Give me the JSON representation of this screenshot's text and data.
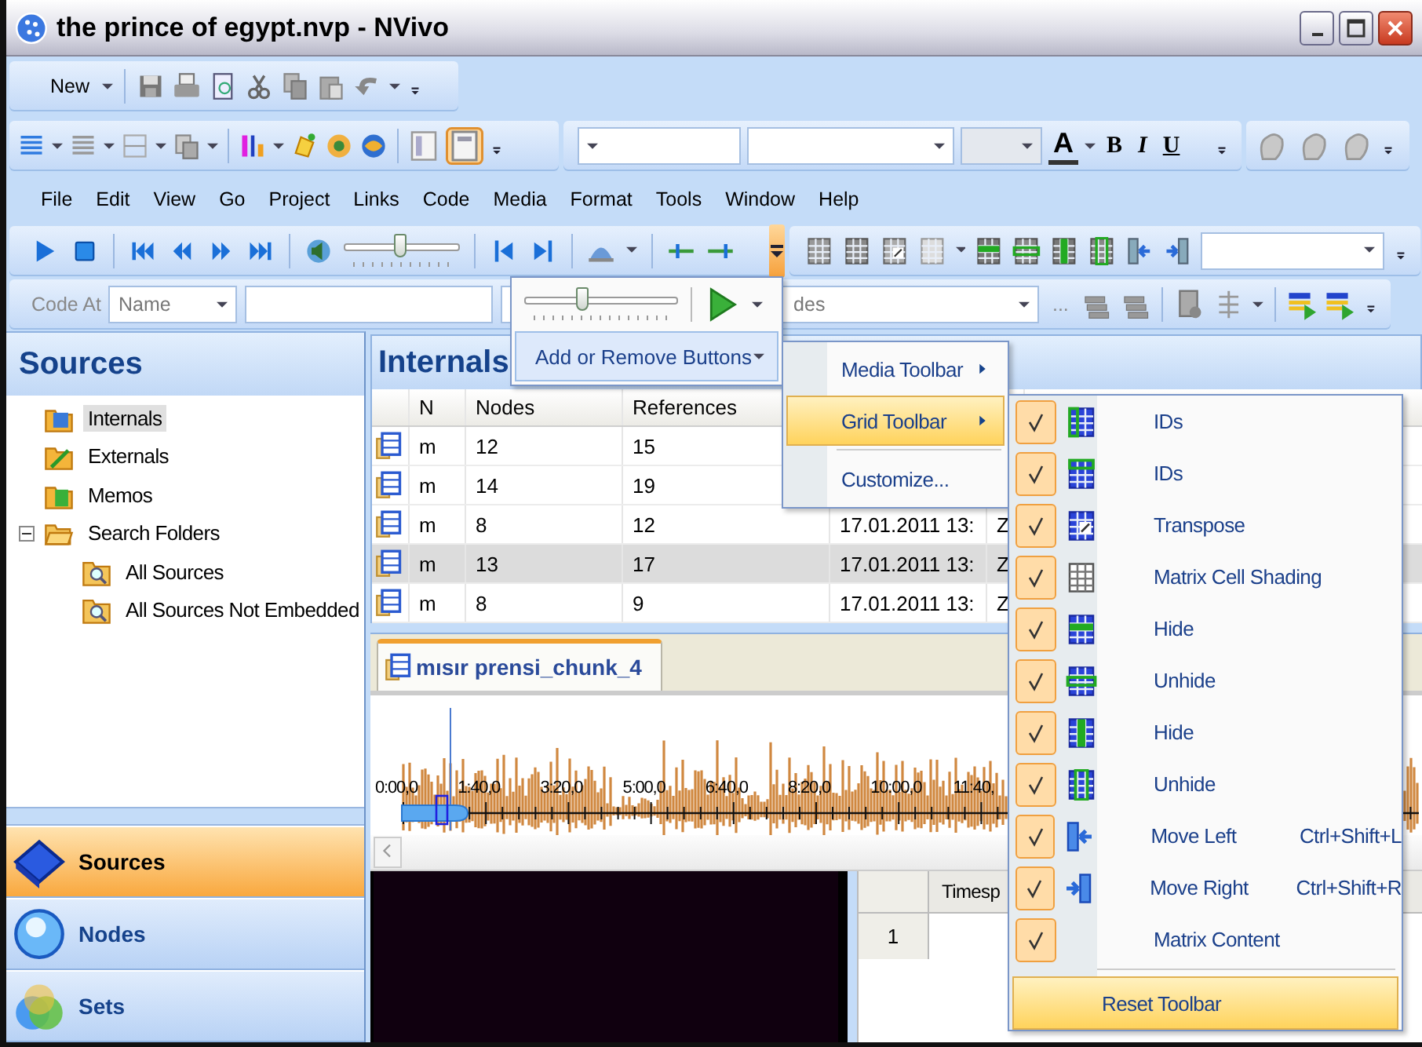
{
  "window": {
    "title": "the prince of egypt.nvp - NVivo"
  },
  "standard_toolbar": {
    "new_label": "New"
  },
  "format_toolbar": {
    "font_color": "A",
    "bold": "B",
    "italic": "I",
    "underline": "U"
  },
  "menu_bar": [
    "File",
    "Edit",
    "View",
    "Go",
    "Project",
    "Links",
    "Code",
    "Media",
    "Format",
    "Tools",
    "Window",
    "Help"
  ],
  "media_toolbar": {
    "level": 0.48
  },
  "code_bar": {
    "label": "Code At",
    "name_field": "Name",
    "nodes_field": "des",
    "more": "..."
  },
  "sources_panel": {
    "title": "Sources",
    "tree": [
      {
        "label": "Internals",
        "selected": true
      },
      {
        "label": "Externals",
        "selected": false
      },
      {
        "label": "Memos",
        "selected": false
      },
      {
        "label": "Search Folders",
        "selected": false,
        "expanded": true,
        "children": [
          {
            "label": "All Sources",
            "selected": false
          },
          {
            "label": "All Sources Not Embedded",
            "selected": false
          }
        ]
      }
    ]
  },
  "navigation": [
    {
      "label": "Sources",
      "selected": true
    },
    {
      "label": "Nodes",
      "selected": false
    },
    {
      "label": "Sets",
      "selected": false
    }
  ],
  "internals": {
    "title": "Internals",
    "columns": [
      "N",
      "Nodes",
      "References"
    ],
    "rows": [
      {
        "cells": [
          "m",
          "12",
          "15"
        ],
        "selected": false
      },
      {
        "cells": [
          "m",
          "14",
          "19"
        ],
        "selected": false
      },
      {
        "cells": [
          "m",
          "8",
          "12",
          "17.01.2011 13:",
          "Z"
        ],
        "selected": false
      },
      {
        "cells": [
          "m",
          "13",
          "17",
          "17.01.2011 13:",
          "Z"
        ],
        "selected": true
      },
      {
        "cells": [
          "m",
          "8",
          "9",
          "17.01.2011 13:",
          "Z"
        ],
        "selected": false
      }
    ]
  },
  "media_tab": {
    "label": "mısır prensi_chunk_4"
  },
  "timeline": {
    "labels": [
      "0:00,0",
      "1:40,0",
      "3:20,0",
      "5:00,0",
      "6:40,0",
      "8:20,0",
      "10:00,0",
      "11:40,"
    ]
  },
  "transcript": {
    "columns": [
      "Timesp"
    ],
    "rows": [
      "1"
    ]
  },
  "toolbar_options": {
    "level": 0.38,
    "menu_label": "Add or Remove Buttons",
    "selected": true
  },
  "toolbar_menu": [
    {
      "label": "Media Toolbar",
      "kind": "submenu",
      "selected": false
    },
    {
      "label": "Grid Toolbar",
      "kind": "submenu",
      "selected": true
    },
    {
      "label": "Customize...",
      "kind": "command",
      "selected": false
    }
  ],
  "grid_toolbar_menu": {
    "items": [
      {
        "label": "IDs",
        "checked": true
      },
      {
        "label": "IDs",
        "checked": true
      },
      {
        "label": "Transpose",
        "checked": true
      },
      {
        "label": "Matrix Cell Shading",
        "checked": true
      },
      {
        "label": "Hide",
        "checked": true
      },
      {
        "label": "Unhide",
        "checked": true
      },
      {
        "label": "Hide",
        "checked": true
      },
      {
        "label": "Unhide",
        "checked": true
      },
      {
        "label": "Move Left",
        "checked": true,
        "shortcut": "Ctrl+Shift+L"
      },
      {
        "label": "Move Right",
        "checked": true,
        "shortcut": "Ctrl+Shift+R"
      },
      {
        "label": "Matrix Content",
        "checked": true
      }
    ],
    "reset": {
      "label": "Reset Toolbar",
      "selected": true
    }
  }
}
